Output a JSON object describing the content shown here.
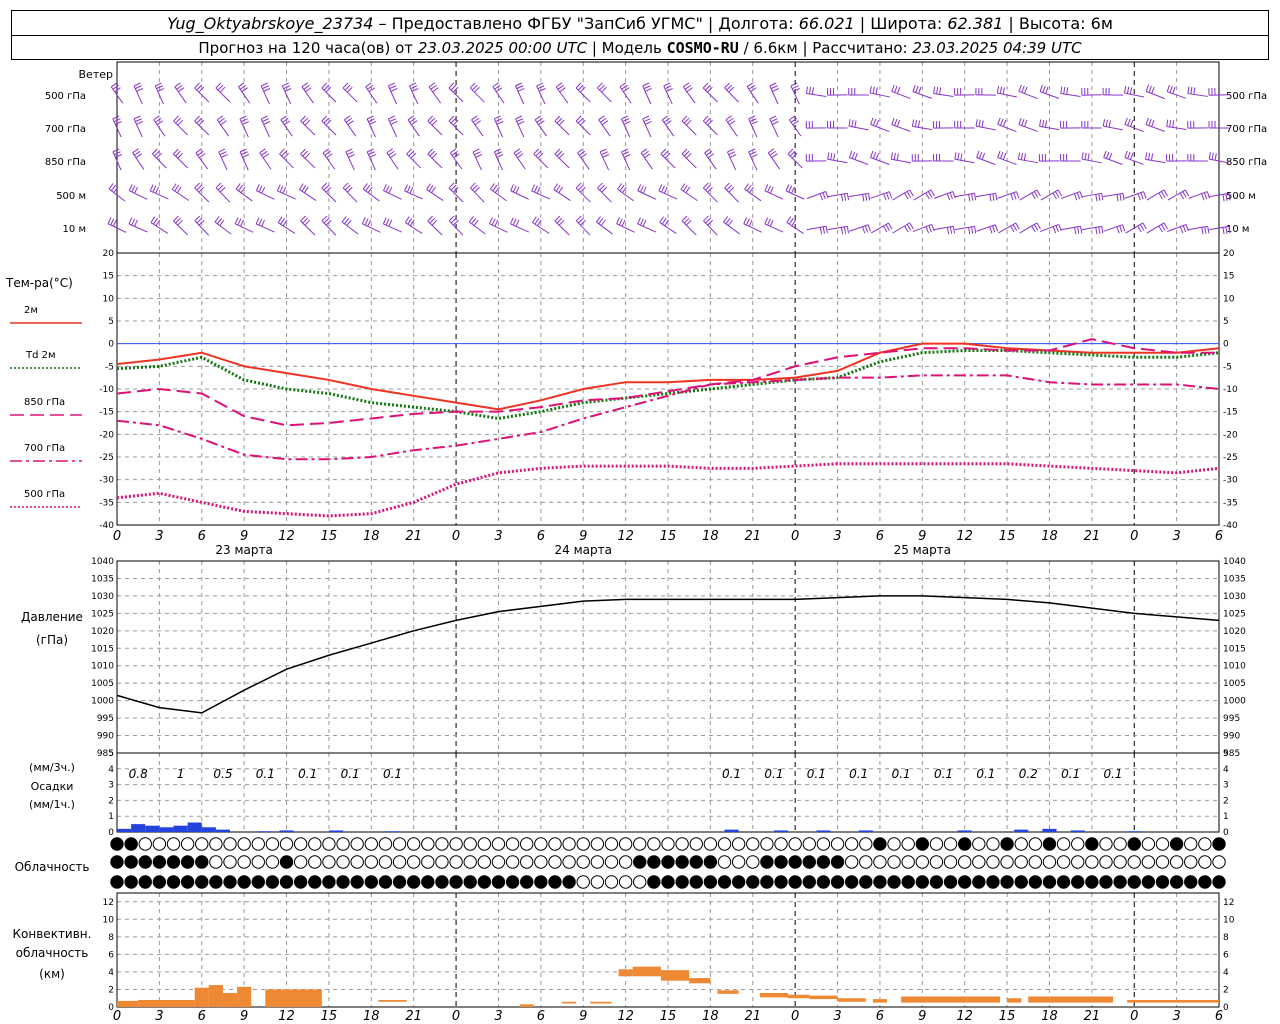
{
  "header": {
    "station": "Yug_Oktyabrskoye_23734",
    "provider": " – Предоставлено ФГБУ \"ЗапСиб УГМС\" | Долгота: ",
    "lon": "66.021",
    "lat_label": " | Широта: ",
    "lat": "62.381",
    "alt_label": " | Высота: 6м",
    "forecast_prefix": "Прогноз на 120 часа(ов) от ",
    "forecast_time": "23.03.2025 00:00 UTC",
    "model_prefix": " | Модель ",
    "model": "COSMO-RU",
    "model_res": " / 6.6км",
    "calc_prefix": " | Рассчитано: ",
    "calc_time": "23.03.2025 04:39 UTC"
  },
  "labels": {
    "wind": "Ветер",
    "levels": [
      "500 гПа",
      "700 гПа",
      "850 гПа",
      "500 м",
      "10 м"
    ],
    "temp_title": "Тем-ра(°C)",
    "legend": [
      "2м",
      "Td  2м",
      "850 гПа",
      "700 гПа",
      "500 гПа"
    ],
    "pressure": [
      "Давление",
      "(гПа)"
    ],
    "precip_units": "(мм/3ч.)",
    "precip": [
      "Осадки",
      "(мм/1ч.)"
    ],
    "cloud": "Облачность",
    "conv": [
      "Конвективн.",
      "облачность",
      "(км)"
    ],
    "dates": [
      "23 марта",
      "24 марта",
      "25 марта"
    ]
  },
  "colors": {
    "t2m": "#ee3322",
    "td2m": "#117711",
    "t850": "#dd1177",
    "t700": "#dd1177",
    "t500": "#dd1177",
    "wind": "#8833cc",
    "precip": "#2244dd",
    "conv": "#ee8833"
  },
  "chart_data": [
    {
      "type": "line",
      "title": "Тем-ра(°C)",
      "x_hours": [
        0,
        3,
        6,
        9,
        12,
        15,
        18,
        21,
        24,
        27,
        30,
        33,
        36,
        39,
        42,
        45,
        48,
        51,
        54,
        57,
        60,
        63,
        66,
        69,
        72,
        75,
        78
      ],
      "xtick_labels": [
        "0",
        "3",
        "6",
        "9",
        "12",
        "15",
        "18",
        "21",
        "0",
        "3",
        "6",
        "9",
        "12",
        "15",
        "18",
        "21",
        "0",
        "3",
        "6",
        "9",
        "12",
        "15",
        "18",
        "21",
        "0",
        "3",
        "6"
      ],
      "ylim": [
        -40,
        20
      ],
      "yticks": [
        -40,
        -35,
        -30,
        -25,
        -20,
        -15,
        -10,
        -5,
        0,
        5,
        10,
        15,
        20
      ],
      "series": [
        {
          "name": "2м",
          "values": [
            -4.5,
            -3.5,
            -2,
            -5,
            -6.5,
            -8,
            -10,
            -11.5,
            -13,
            -14.5,
            -12.5,
            -10,
            -8.5,
            -8.5,
            -8,
            -8,
            -7.5,
            -6,
            -2,
            0,
            0,
            -1,
            -1.5,
            -2,
            -2,
            -2,
            -1
          ]
        },
        {
          "name": "Td 2м",
          "values": [
            -5.5,
            -5,
            -3,
            -8,
            -10,
            -11,
            -13,
            -14,
            -15,
            -16.5,
            -15,
            -13,
            -12,
            -11,
            -10,
            -9,
            -8,
            -7.5,
            -4,
            -2,
            -1.5,
            -1.5,
            -2,
            -2.5,
            -3,
            -3,
            -2
          ]
        },
        {
          "name": "850 гПа",
          "values": [
            -11,
            -10,
            -11,
            -16,
            -18,
            -17.5,
            -16.5,
            -15.5,
            -15,
            -15,
            -14,
            -12.5,
            -12,
            -10.5,
            -9,
            -8,
            -5,
            -3,
            -2,
            -1,
            -1,
            -1.5,
            -1.5,
            1,
            -1,
            -2,
            -2
          ]
        },
        {
          "name": "700 гПа",
          "values": [
            -17,
            -18,
            -21,
            -24.5,
            -25.5,
            -25.5,
            -25,
            -23.5,
            -22.5,
            -21,
            -19.5,
            -16.5,
            -14,
            -11.5,
            -9,
            -8.5,
            -8,
            -7.5,
            -7.5,
            -7,
            -7,
            -7,
            -8.5,
            -9,
            -9,
            -9,
            -10
          ]
        },
        {
          "name": "500 гПа",
          "values": [
            -34,
            -33,
            -35,
            -37,
            -37.5,
            -38,
            -37.5,
            -35,
            -31,
            -28.5,
            -27.5,
            -27,
            -27,
            -27,
            -27.5,
            -27.5,
            -27,
            -26.5,
            -26.5,
            -26.5,
            -26.5,
            -26.5,
            -27,
            -27.5,
            -28,
            -28.5,
            -27.5
          ]
        }
      ]
    },
    {
      "type": "line",
      "title": "Давление (гПа)",
      "x_hours": [
        0,
        3,
        6,
        9,
        12,
        15,
        18,
        21,
        24,
        27,
        30,
        33,
        36,
        39,
        42,
        45,
        48,
        51,
        54,
        57,
        60,
        63,
        66,
        69,
        72,
        75,
        78
      ],
      "ylim": [
        985,
        1040
      ],
      "yticks": [
        985,
        990,
        995,
        1000,
        1005,
        1010,
        1015,
        1020,
        1025,
        1030,
        1035,
        1040
      ],
      "series": [
        {
          "name": "Давление",
          "values": [
            1001.5,
            998,
            996.5,
            1003,
            1009,
            1013,
            1016.5,
            1020,
            1023,
            1025.5,
            1027,
            1028.5,
            1029,
            1029,
            1029,
            1029,
            1029,
            1029.5,
            1030,
            1030,
            1029.5,
            1029,
            1028,
            1026.5,
            1025,
            1024,
            1023
          ]
        }
      ]
    },
    {
      "type": "bar",
      "title": "Осадки (мм/1ч.)",
      "ylim": [
        0,
        5
      ],
      "precip_bars": [
        {
          "h": 0.5,
          "v": 0.2
        },
        {
          "h": 1.5,
          "v": 0.5
        },
        {
          "h": 2.5,
          "v": 0.4
        },
        {
          "h": 3.5,
          "v": 0.3
        },
        {
          "h": 4.5,
          "v": 0.4
        },
        {
          "h": 5.5,
          "v": 0.6
        },
        {
          "h": 6.5,
          "v": 0.3
        },
        {
          "h": 7.5,
          "v": 0.15
        },
        {
          "h": 10.5,
          "v": 0.05
        },
        {
          "h": 12,
          "v": 0.1
        },
        {
          "h": 15.5,
          "v": 0.1
        },
        {
          "h": 19.5,
          "v": 0.05
        },
        {
          "h": 43.5,
          "v": 0.15
        },
        {
          "h": 47,
          "v": 0.1
        },
        {
          "h": 50,
          "v": 0.1
        },
        {
          "h": 53,
          "v": 0.1
        },
        {
          "h": 60,
          "v": 0.1
        },
        {
          "h": 64,
          "v": 0.15
        },
        {
          "h": 66,
          "v": 0.2
        },
        {
          "h": 68,
          "v": 0.1
        },
        {
          "h": 72,
          "v": 0.05
        }
      ],
      "labels_3h": [
        {
          "h": 1.5,
          "t": "0.8"
        },
        {
          "h": 4.5,
          "t": "1"
        },
        {
          "h": 7.5,
          "t": "0.5"
        },
        {
          "h": 10.5,
          "t": "0.1"
        },
        {
          "h": 13.5,
          "t": "0.1"
        },
        {
          "h": 16.5,
          "t": "0.1"
        },
        {
          "h": 19.5,
          "t": "0.1"
        },
        {
          "h": 43.5,
          "t": "0.1"
        },
        {
          "h": 46.5,
          "t": "0.1"
        },
        {
          "h": 49.5,
          "t": "0.1"
        },
        {
          "h": 52.5,
          "t": "0.1"
        },
        {
          "h": 55.5,
          "t": "0.1"
        },
        {
          "h": 58.5,
          "t": "0.1"
        },
        {
          "h": 61.5,
          "t": "0.1"
        },
        {
          "h": 64.5,
          "t": "0.2"
        },
        {
          "h": 67.5,
          "t": "0.1"
        },
        {
          "h": 70.5,
          "t": "0.1"
        }
      ]
    },
    {
      "type": "bar",
      "title": "Конвективн. облачность (км)",
      "ylim": [
        0,
        13
      ],
      "yticks": [
        0,
        2,
        4,
        6,
        8,
        10,
        12
      ],
      "conv_bars": [
        {
          "h0": 0,
          "h1": 1.5,
          "lo": 0,
          "hi": 0.7
        },
        {
          "h0": 1.5,
          "h1": 5.5,
          "lo": 0,
          "hi": 0.8
        },
        {
          "h0": 5.5,
          "h1": 6.5,
          "lo": 0,
          "hi": 2.2
        },
        {
          "h0": 6.5,
          "h1": 7.5,
          "lo": 0,
          "hi": 2.5
        },
        {
          "h0": 7.5,
          "h1": 8.5,
          "lo": 0,
          "hi": 1.6
        },
        {
          "h0": 8.5,
          "h1": 9.5,
          "lo": 0,
          "hi": 2.3
        },
        {
          "h0": 10.5,
          "h1": 14.5,
          "lo": 0,
          "hi": 2.0
        },
        {
          "h0": 18.5,
          "h1": 20.5,
          "lo": 0.6,
          "hi": 0.8
        },
        {
          "h0": 28.5,
          "h1": 29.5,
          "lo": 0,
          "hi": 0.3
        },
        {
          "h0": 31.5,
          "h1": 32.5,
          "lo": 0.4,
          "hi": 0.6
        },
        {
          "h0": 33.5,
          "h1": 35,
          "lo": 0.4,
          "hi": 0.6
        },
        {
          "h0": 35.5,
          "h1": 36.5,
          "lo": 3.5,
          "hi": 4.3
        },
        {
          "h0": 36.5,
          "h1": 38.5,
          "lo": 3.5,
          "hi": 4.6
        },
        {
          "h0": 38.5,
          "h1": 40.5,
          "lo": 3,
          "hi": 4.2
        },
        {
          "h0": 40.5,
          "h1": 42,
          "lo": 2.7,
          "hi": 3.3
        },
        {
          "h0": 42.5,
          "h1": 44,
          "lo": 1.5,
          "hi": 1.9
        },
        {
          "h0": 45.5,
          "h1": 47.5,
          "lo": 1.1,
          "hi": 1.6
        },
        {
          "h0": 47.5,
          "h1": 49,
          "lo": 1.0,
          "hi": 1.4
        },
        {
          "h0": 49,
          "h1": 51,
          "lo": 0.9,
          "hi": 1.3
        },
        {
          "h0": 51,
          "h1": 53,
          "lo": 0.6,
          "hi": 1.0
        },
        {
          "h0": 53.5,
          "h1": 54.5,
          "lo": 0.5,
          "hi": 0.9
        },
        {
          "h0": 55.5,
          "h1": 59.5,
          "lo": 0.5,
          "hi": 1.2
        },
        {
          "h0": 59.5,
          "h1": 62.5,
          "lo": 0.5,
          "hi": 1.2
        },
        {
          "h0": 63,
          "h1": 64,
          "lo": 0.5,
          "hi": 1.0
        },
        {
          "h0": 64.5,
          "h1": 70.5,
          "lo": 0.5,
          "hi": 1.2
        },
        {
          "h0": 71.5,
          "h1": 78,
          "lo": 0.5,
          "hi": 0.8
        }
      ]
    }
  ]
}
